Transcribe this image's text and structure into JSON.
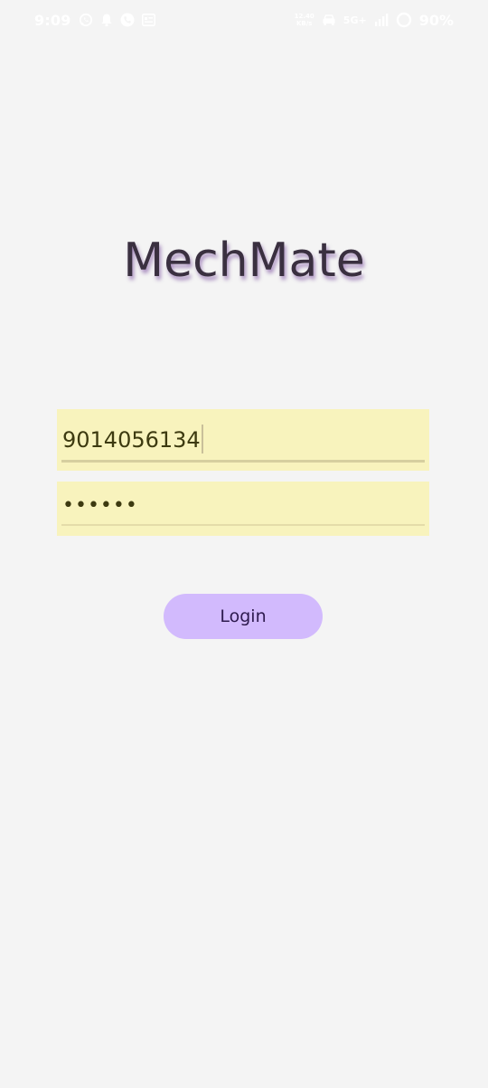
{
  "status_bar": {
    "time": "9:09",
    "speed_value": "12.40",
    "speed_unit": "KB/s",
    "network": "5G+",
    "battery": "90%"
  },
  "app": {
    "title": "MechMate"
  },
  "login_form": {
    "phone_value": "9014056134",
    "password_mask": "••••••",
    "login_label": "Login"
  },
  "colors": {
    "background": "#f4f4f4",
    "input_background": "#f8f3bd",
    "button_background": "#d2bafd",
    "title_text": "#3a3040",
    "title_shadow": "#6e3c96"
  }
}
